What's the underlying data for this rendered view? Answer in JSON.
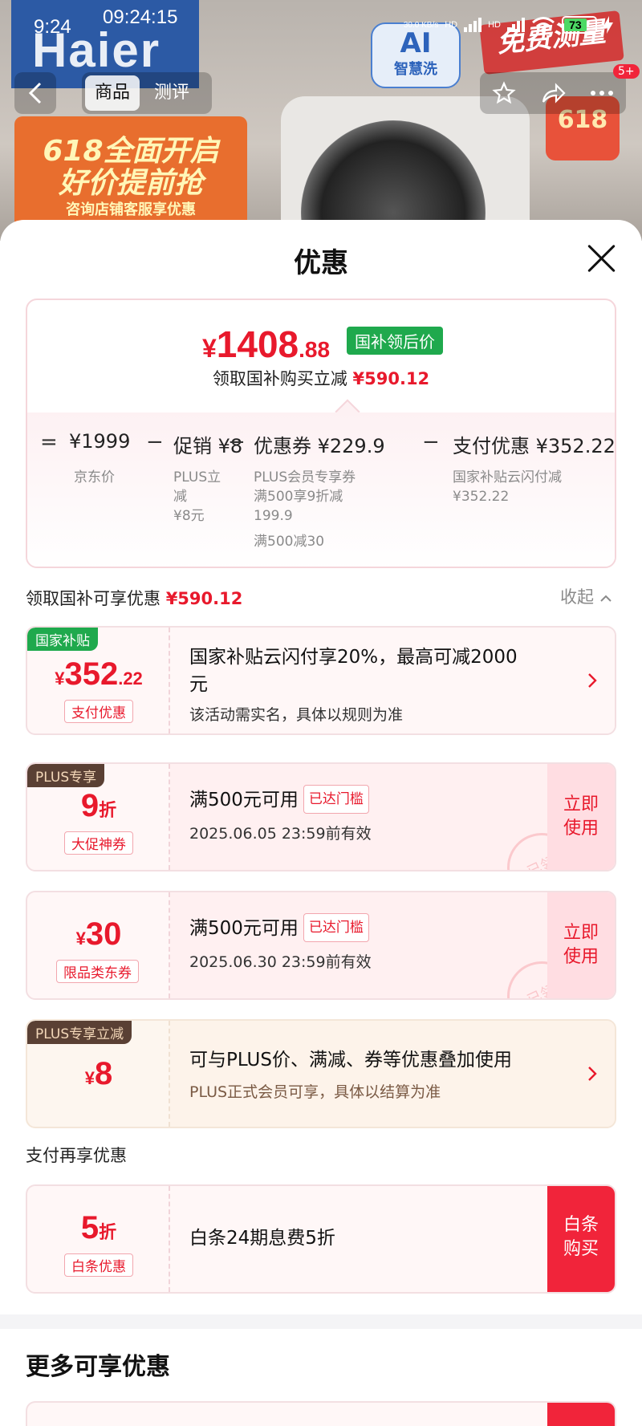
{
  "status_bar": {
    "time": "9:24",
    "clock": "09:24:15",
    "net_speed": "30.0 KB/s",
    "net_type_1": "HD",
    "net_type_2": "HD",
    "battery": "73"
  },
  "background": {
    "logo_text": "Haier",
    "ai_badge_top": "AI",
    "ai_badge_bottom": "智慧洗",
    "free_badge": "免费测量",
    "promo_line1": "618全面开启",
    "promo_line2": "好价提前抢",
    "promo_line3": "咨询店铺客服享优惠",
    "badge_618": "618"
  },
  "top_nav": {
    "tabs": [
      {
        "label": "商品",
        "active": true
      },
      {
        "label": "测评",
        "active": false
      }
    ],
    "notification_badge": "5+"
  },
  "sheet": {
    "title": "优惠",
    "summary": {
      "price_symbol": "¥",
      "price_int": "1408",
      "price_dec": ".88",
      "price_tag": "国补领后价",
      "subtitle_prefix": "领取国补购买立减",
      "subtitle_amount": "¥590.12",
      "calc": {
        "eq": "=",
        "minus": "−",
        "jd_price": "¥1999",
        "jd_price_label": "京东价",
        "promo": "促销 ¥8",
        "promo_desc_1": "PLUS立",
        "promo_desc_2": "减",
        "promo_desc_3": "¥8元",
        "coupon": "优惠券 ¥229.9",
        "coupon_desc_1": "PLUS会员专享券",
        "coupon_desc_2": "满500享9折减",
        "coupon_desc_3": "199.9",
        "coupon_desc_4": "满500减30",
        "pay": "支付优惠 ¥352.22",
        "pay_desc_1": "国家补贴云闪付减",
        "pay_desc_2": "¥352.22"
      }
    },
    "section1": {
      "title_prefix": "领取国补可享优惠",
      "title_amount": "¥590.12",
      "collapse_label": "收起"
    },
    "card_subsidy": {
      "corner_tag": "国家补贴",
      "amount_symbol": "¥",
      "amount_int": "352",
      "amount_dec": ".22",
      "pill": "支付优惠",
      "title_line1": "国家补贴云闪付享20%，最高可减2000",
      "title_line2": "元",
      "desc": "该活动需实名，具体以规则为准"
    },
    "card_coupon_9": {
      "corner_tag": "PLUS专享",
      "amount": "9",
      "amount_unit": "折",
      "pill": "大促神券",
      "title": "满500元可用",
      "reached_tag": "已达门槛",
      "valid": "2025.06.05  23:59前有效",
      "use_label_1": "立即",
      "use_label_2": "使用",
      "stamp": "已领"
    },
    "card_coupon_30": {
      "amount_symbol": "¥",
      "amount": "30",
      "pill": "限品类东券",
      "title": "满500元可用",
      "reached_tag": "已达门槛",
      "valid": "2025.06.30  23:59前有效",
      "use_label_1": "立即",
      "use_label_2": "使用",
      "stamp": "已领"
    },
    "card_plus8": {
      "corner_tag": "PLUS专享立减",
      "amount_symbol": "¥",
      "amount": "8",
      "title": "可与PLUS价、满减、券等优惠叠加使用",
      "desc": "PLUS正式会员可享，具体以结算为准"
    },
    "section2": {
      "title": "支付再享优惠"
    },
    "card_baitiao": {
      "amount": "5",
      "amount_unit": "折",
      "pill": "白条优惠",
      "title": "白条24期息费5折",
      "buy_label_1": "白条",
      "buy_label_2": "购买"
    },
    "more_title": "更多可享优惠"
  },
  "colors": {
    "accent_red": "#e8192c",
    "subsidy_green": "#1fa94d",
    "plus_brown": "#5a4034"
  }
}
